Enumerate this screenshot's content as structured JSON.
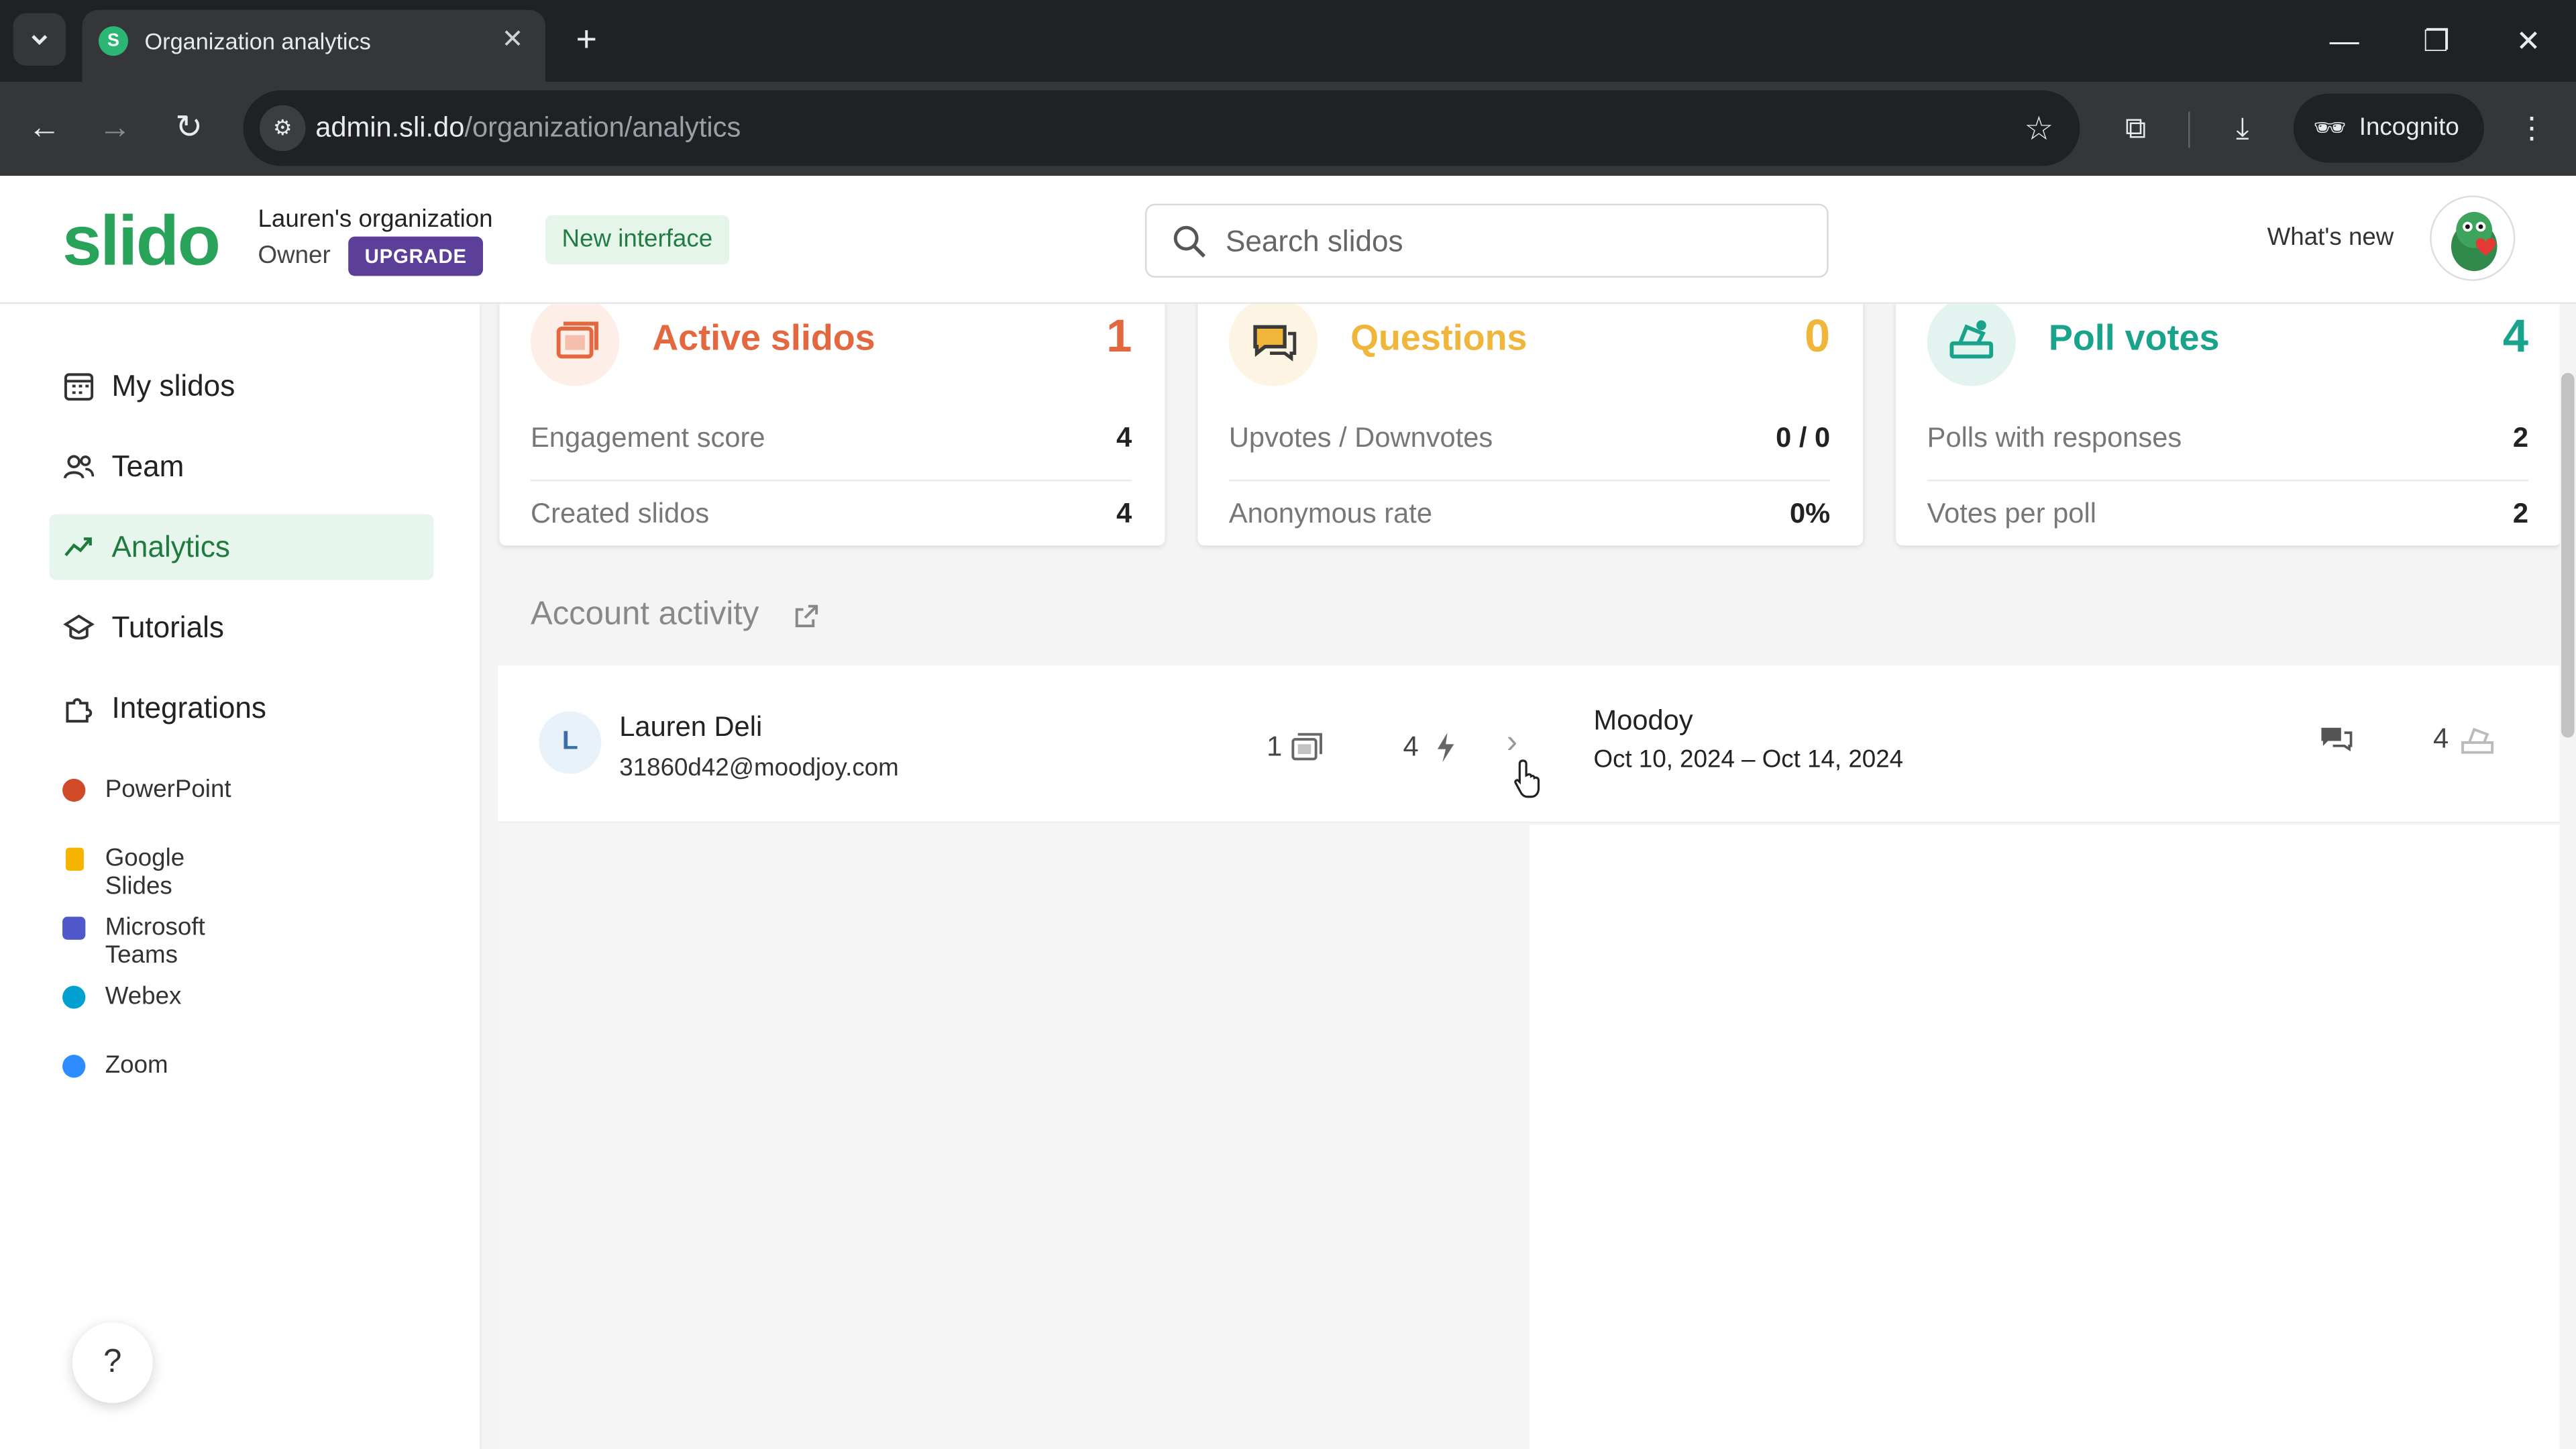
{
  "browser": {
    "tab_title": "Organization analytics",
    "tab_favicon_letter": "S",
    "url_host": "admin.sli.do",
    "url_path": "/organization/analytics",
    "incognito_label": "Incognito"
  },
  "header": {
    "logo": "slido",
    "org_name": "Lauren's organization",
    "role": "Owner",
    "upgrade_label": "UPGRADE",
    "new_interface_label": "New interface",
    "search_placeholder": "Search slidos",
    "whats_new_label": "What's new"
  },
  "sidebar": {
    "nav": [
      {
        "label": "My slidos",
        "icon": "calendar-grid-icon",
        "active": false
      },
      {
        "label": "Team",
        "icon": "people-icon",
        "active": false
      },
      {
        "label": "Analytics",
        "icon": "trend-icon",
        "active": true
      },
      {
        "label": "Tutorials",
        "icon": "graduation-cap-icon",
        "active": false
      },
      {
        "label": "Integrations",
        "icon": "puzzle-icon",
        "active": false
      }
    ],
    "integrations": [
      {
        "label": "PowerPoint",
        "color": "#d04a28"
      },
      {
        "label": "Google Slides",
        "color": "#f4b400"
      },
      {
        "label": "Microsoft Teams",
        "color": "#5059c9"
      },
      {
        "label": "Webex",
        "color": "#00a0d1"
      },
      {
        "label": "Zoom",
        "color": "#2d8cff"
      }
    ],
    "help_label": "?"
  },
  "stats": [
    {
      "title": "Active slidos",
      "value": "1",
      "color": "#e4683f",
      "bg": "#fdeee8",
      "icon": "slides-stack-icon",
      "rows": [
        {
          "label": "Engagement score",
          "value": "4"
        },
        {
          "label": "Created slidos",
          "value": "4"
        }
      ]
    },
    {
      "title": "Questions",
      "value": "0",
      "color": "#f0b63b",
      "bg": "#fdf4e3",
      "icon": "speech-bubbles-icon",
      "rows": [
        {
          "label": "Upvotes / Downvotes",
          "value": "0 / 0"
        },
        {
          "label": "Anonymous rate",
          "value": "0%"
        }
      ]
    },
    {
      "title": "Poll votes",
      "value": "4",
      "color": "#19a38a",
      "bg": "#e3f4f0",
      "icon": "poll-vote-icon",
      "rows": [
        {
          "label": "Polls with responses",
          "value": "2"
        },
        {
          "label": "Votes per poll",
          "value": "2"
        }
      ]
    }
  ],
  "activity": {
    "section_title": "Account activity",
    "rows": [
      {
        "initial": "L",
        "name": "Lauren Deli",
        "email": "31860d42@moodjoy.com",
        "slidos_count": "1",
        "engagement_count": "4",
        "event_name": "Moodoy",
        "event_dates": "Oct 10, 2024 – Oct 14, 2024",
        "poll_votes_count": "4"
      }
    ]
  }
}
